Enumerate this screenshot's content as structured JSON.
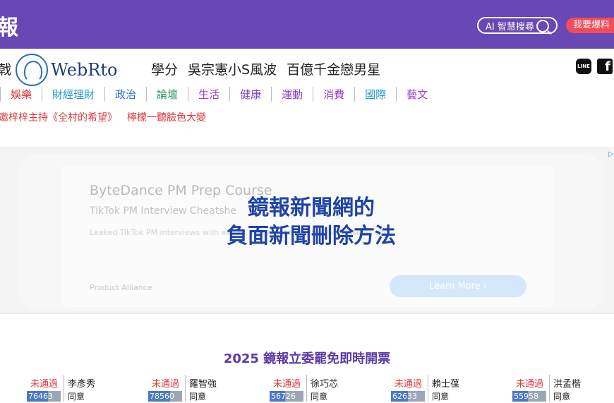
{
  "header": {
    "brand": "報",
    "ai_search_label": "AI 智慧搜尋",
    "report_label": "我要爆料"
  },
  "hot_topics": [
    "戟",
    "學分",
    "吳宗憲小S風波",
    "百億千金戀男星"
  ],
  "logo": {
    "text": "WebRto"
  },
  "social": {
    "line_label": "LINE",
    "facebook_label": "f"
  },
  "nav": [
    {
      "label": "娛樂",
      "color": "#e0383e"
    },
    {
      "label": "財經理財",
      "color": "#2196c9"
    },
    {
      "label": "政治",
      "color": "#2f6fc9"
    },
    {
      "label": "論壇",
      "color": "#2d9a6a"
    },
    {
      "label": "生活",
      "color": "#9a3fc8"
    },
    {
      "label": "健康",
      "color": "#7b49c4"
    },
    {
      "label": "運動",
      "color": "#8a3fc8"
    },
    {
      "label": "消費",
      "color": "#8a3fc8"
    },
    {
      "label": "國際",
      "color": "#2196c9"
    },
    {
      "label": "藝文",
      "color": "#9a3fc8"
    }
  ],
  "ticker": [
    "邀梓梓主持《全村的希望》",
    "檸檬一聽臉色大變"
  ],
  "ad": {
    "title": "ByteDance PM Prep Course",
    "subtitle": "TikTok PM Interview Cheatshe",
    "description": "Leaked TikTok PM interviews with expert insights, templates, and insider info",
    "source": "Product Alliance",
    "cta": "Learn More ›"
  },
  "overlay": {
    "text": "鏡報新聞網的\n負面新聞刪除方法"
  },
  "vote": {
    "title": "2025 鏡報立委罷免即時開票",
    "candidates": [
      {
        "status": "未通過",
        "name": "李彥秀",
        "count": "76463",
        "fill": 0.62,
        "agree": "同意"
      },
      {
        "status": "未通過",
        "name": "羅智強",
        "count": "78560",
        "fill": 0.64,
        "agree": "同意"
      },
      {
        "status": "未通過",
        "name": "徐巧芯",
        "count": "56726",
        "fill": 0.46,
        "agree": "同意"
      },
      {
        "status": "未通過",
        "name": "賴士葆",
        "count": "62633",
        "fill": 0.51,
        "agree": "同意"
      },
      {
        "status": "未通過",
        "name": "洪孟楷",
        "count": "55958",
        "fill": 0.45,
        "agree": "同意"
      }
    ]
  }
}
